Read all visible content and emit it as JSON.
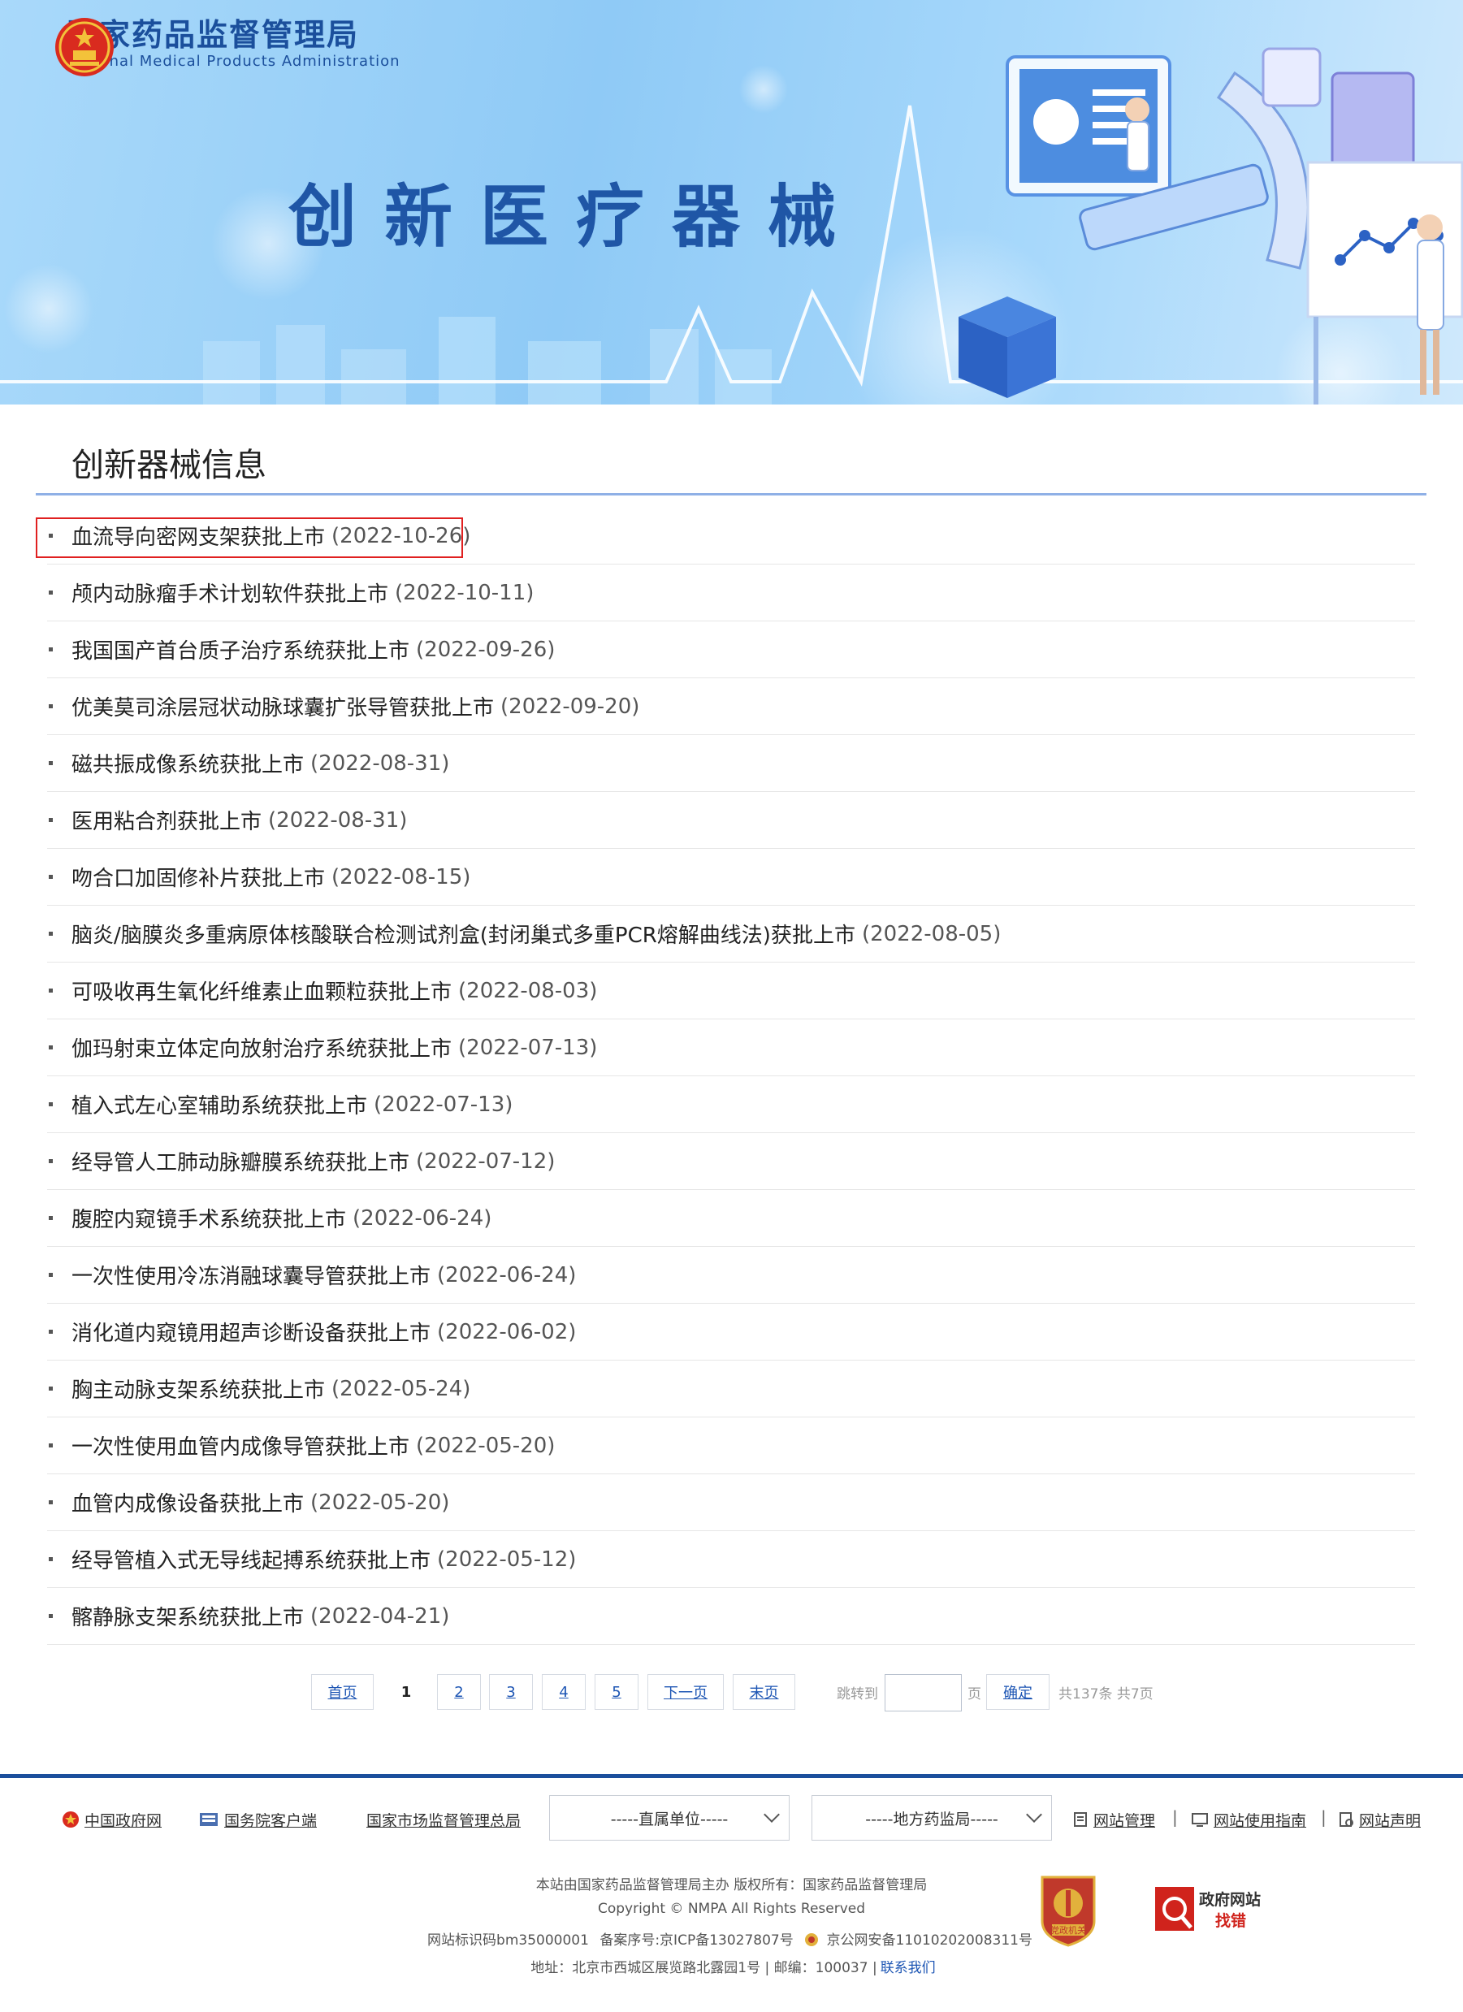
{
  "header": {
    "org_name_cn": "国家药品监督管理局",
    "org_name_en": "National Medical Products Administration",
    "banner_title": "创新医疗器械"
  },
  "section": {
    "title": "创新器械信息"
  },
  "news": [
    {
      "title": "血流导向密网支架获批上市",
      "date": "(2022-10-26)"
    },
    {
      "title": "颅内动脉瘤手术计划软件获批上市",
      "date": "(2022-10-11)"
    },
    {
      "title": "我国国产首台质子治疗系统获批上市",
      "date": "(2022-09-26)"
    },
    {
      "title": "优美莫司涂层冠状动脉球囊扩张导管获批上市",
      "date": "(2022-09-20)"
    },
    {
      "title": "磁共振成像系统获批上市",
      "date": "(2022-08-31)"
    },
    {
      "title": "医用粘合剂获批上市",
      "date": "(2022-08-31)"
    },
    {
      "title": "吻合口加固修补片获批上市",
      "date": "(2022-08-15)"
    },
    {
      "title": "脑炎/脑膜炎多重病原体核酸联合检测试剂盒(封闭巢式多重PCR熔解曲线法)获批上市",
      "date": "(2022-08-05)"
    },
    {
      "title": "可吸收再生氧化纤维素止血颗粒获批上市",
      "date": "(2022-08-03)"
    },
    {
      "title": "伽玛射束立体定向放射治疗系统获批上市",
      "date": "(2022-07-13)"
    },
    {
      "title": "植入式左心室辅助系统获批上市",
      "date": "(2022-07-13)"
    },
    {
      "title": "经导管人工肺动脉瓣膜系统获批上市",
      "date": "(2022-07-12)"
    },
    {
      "title": "腹腔内窥镜手术系统获批上市",
      "date": "(2022-06-24)"
    },
    {
      "title": "一次性使用冷冻消融球囊导管获批上市",
      "date": "(2022-06-24)"
    },
    {
      "title": "消化道内窥镜用超声诊断设备获批上市",
      "date": "(2022-06-02)"
    },
    {
      "title": "胸主动脉支架系统获批上市",
      "date": "(2022-05-24)"
    },
    {
      "title": "一次性使用血管内成像导管获批上市",
      "date": "(2022-05-20)"
    },
    {
      "title": "血管内成像设备获批上市",
      "date": "(2022-05-20)"
    },
    {
      "title": "经导管植入式无导线起搏系统获批上市",
      "date": "(2022-05-12)"
    },
    {
      "title": "髂静脉支架系统获批上市",
      "date": "(2022-04-21)"
    }
  ],
  "pagination": {
    "first": "首页",
    "current": "1",
    "pages": [
      "2",
      "3",
      "4",
      "5"
    ],
    "next": "下一页",
    "last": "末页",
    "jump_label": "跳转到",
    "page_unit": "页",
    "confirm": "确定",
    "summary": "共137条 共7页"
  },
  "footer": {
    "links": {
      "gov": "中国政府网",
      "state_council": "国务院客户端",
      "samr": "国家市场监督管理总局",
      "site_admin": "网站管理",
      "guide": "网站使用指南",
      "statement": "网站声明"
    },
    "selects": {
      "direct_units": "-----直属单位-----",
      "local_bureaus": "-----地方药监局-----"
    },
    "separator": "|",
    "host": "本站由国家药品监督管理局主办 版权所有：国家药品监督管理局",
    "copyright": "Copyright © NMPA All Rights Reserved",
    "site_code": "网站标识码bm35000001",
    "icp": "备案序号:京ICP备13027807号",
    "police": "京公网安备11010202008311号",
    "address": "地址：北京市西城区展览路北露园1号 | 邮编：100037 |",
    "contact": "联系我们",
    "badge_text": "党政机关",
    "error_badge_line1": "政府网站",
    "error_badge_line2": "找错"
  },
  "colors": {
    "brand_blue": "#1b4f9c",
    "link_blue": "#1e56b4",
    "highlight_red": "#e02020"
  }
}
